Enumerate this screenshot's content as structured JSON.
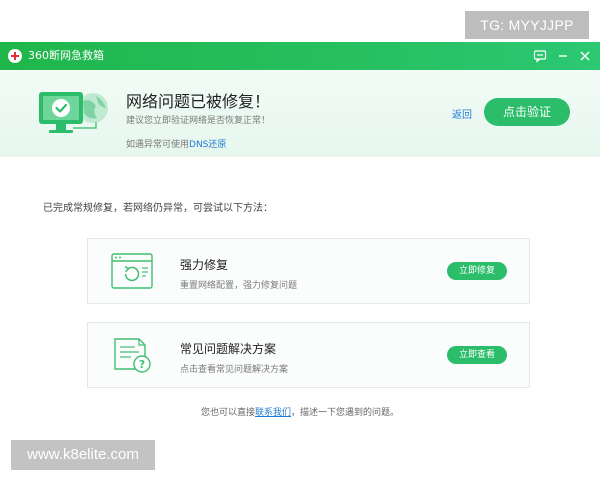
{
  "overlay": {
    "tg_badge": "TG: MYYJJPP",
    "watermark": "www.k8elite.com"
  },
  "window": {
    "title": "360断网急救箱",
    "controls": [
      "feedback-icon",
      "minimize-icon",
      "close-icon"
    ]
  },
  "header": {
    "title": "网络问题已被修复！",
    "subtitle": "建议您立即验证网络是否恢复正常！",
    "hint_prefix": "如遇异常可使用",
    "hint_link": "DNS还原",
    "back_link": "返回",
    "verify_button": "点击验证",
    "icon": "computer-check-globe-icon"
  },
  "main": {
    "intro": "已完成常规修复，若网络仍异常，可尝试以下方法：",
    "cards": [
      {
        "title": "强力修复",
        "desc": "重置网络配置，强力修复问题",
        "button": "立即修复",
        "icon": "browser-repair-icon"
      },
      {
        "title": "常见问题解决方案",
        "desc": "点击查看常见问题解决方案",
        "button": "立即查看",
        "icon": "document-help-icon"
      }
    ]
  },
  "footer": {
    "prefix": "您也可以直接",
    "link": "联系我们",
    "suffix": "，描述一下您遇到的问题。"
  },
  "colors": {
    "titlebar": "#22b955",
    "accent": "#2bbd6a",
    "link": "#1f7ad4",
    "header_bg": "#eaf8f0"
  }
}
